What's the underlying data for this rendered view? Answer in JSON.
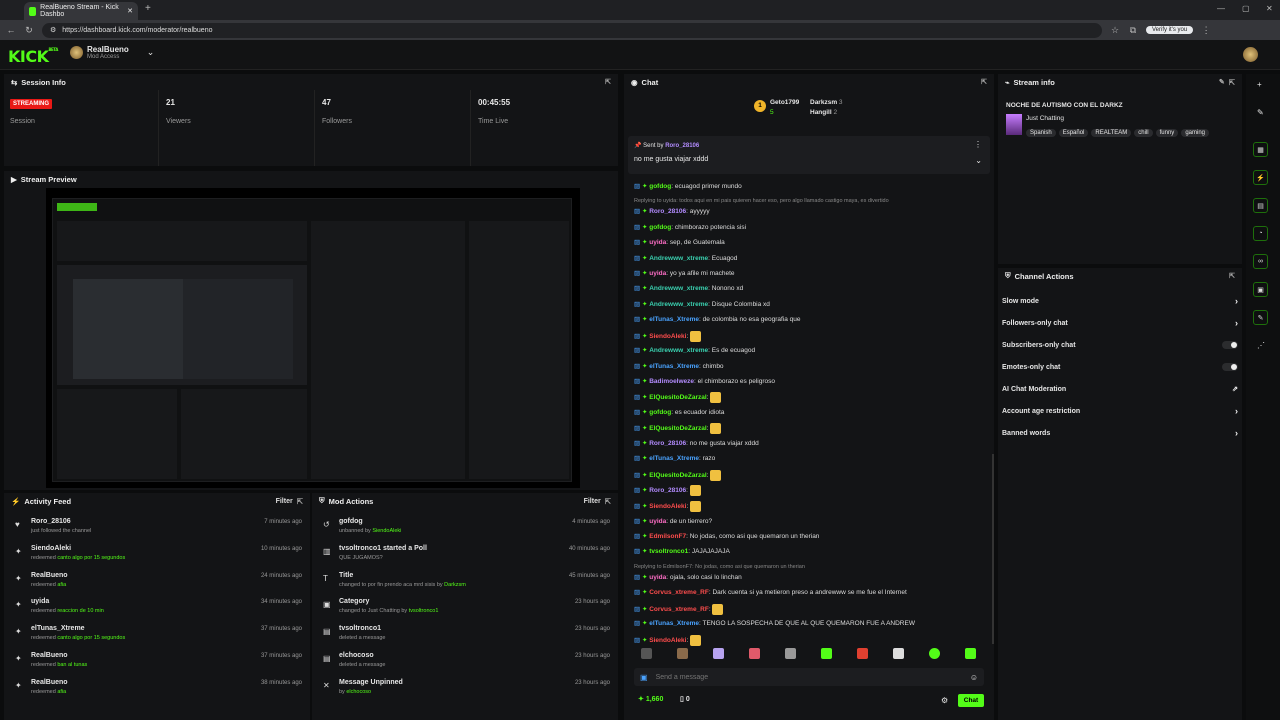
{
  "browser": {
    "tab_title": "RealBueno Stream - Kick Dashbo",
    "url": "https://dashboard.kick.com/moderator/realbueno",
    "verify_label": "Verify it's you"
  },
  "header": {
    "logo": "KICK",
    "logo_sup": "BETA",
    "channel_name": "RealBueno",
    "channel_role": "Mod Access"
  },
  "session": {
    "title": "Session Info",
    "status_badge": "STREAMING",
    "status_label": "Session",
    "viewers": "21",
    "viewers_label": "Viewers",
    "followers": "47",
    "followers_label": "Followers",
    "time_live": "00:45:55",
    "time_live_label": "Time Live"
  },
  "preview": {
    "title": "Stream Preview"
  },
  "activity": {
    "title": "Activity Feed",
    "filter": "Filter",
    "items": [
      {
        "icon": "heart-icon",
        "glyph": "♥",
        "user": "Roro_28106",
        "desc": "just followed the channel",
        "hl": "",
        "time": "7 minutes ago"
      },
      {
        "icon": "redeem-icon",
        "glyph": "✦",
        "user": "SiendoAleki",
        "desc": "redeemed",
        "hl": "canto algo por 15 segundos",
        "time": "10 minutes ago"
      },
      {
        "icon": "redeem-icon",
        "glyph": "✦",
        "user": "RealBueno",
        "desc": "redeemed",
        "hl": "afia",
        "time": "24 minutes ago"
      },
      {
        "icon": "redeem-icon",
        "glyph": "✦",
        "user": "uyida",
        "desc": "redeemed",
        "hl": "reaccion de 10 min",
        "time": "34 minutes ago"
      },
      {
        "icon": "redeem-icon",
        "glyph": "✦",
        "user": "elTunas_Xtreme",
        "desc": "redeemed",
        "hl": "canto algo por 15 segundos",
        "time": "37 minutes ago"
      },
      {
        "icon": "redeem-icon",
        "glyph": "✦",
        "user": "RealBueno",
        "desc": "redeemed",
        "hl": "ban al tunas",
        "time": "37 minutes ago"
      },
      {
        "icon": "redeem-icon",
        "glyph": "✦",
        "user": "RealBueno",
        "desc": "redeemed",
        "hl": "afia",
        "time": "38 minutes ago"
      }
    ]
  },
  "modactions": {
    "title": "Mod Actions",
    "filter": "Filter",
    "items": [
      {
        "icon": "unban-icon",
        "glyph": "↺",
        "title": "gofdog",
        "desc": "unbanned by",
        "hl": "SiendoAleki",
        "time": "4 minutes ago"
      },
      {
        "icon": "poll-icon",
        "glyph": "▥",
        "title": "tvsoltronco1 started a Poll",
        "desc": "QUE JUGAMOS?",
        "hl": "",
        "time": "40 minutes ago"
      },
      {
        "icon": "title-icon",
        "glyph": "T",
        "title": "Title",
        "desc": "changed to por fin prendo aca mrd sisis by",
        "hl": "Darkzsm",
        "time": "45 minutes ago"
      },
      {
        "icon": "category-icon",
        "glyph": "▣",
        "title": "Category",
        "desc": "changed to Just Chatting by",
        "hl": "tvsoltronco1",
        "time": "23 hours ago"
      },
      {
        "icon": "delete-icon",
        "glyph": "▤",
        "title": "tvsoltronco1",
        "desc": "deleted a message",
        "hl": "",
        "time": "23 hours ago"
      },
      {
        "icon": "delete-icon",
        "glyph": "▤",
        "title": "elchocoso",
        "desc": "deleted a message",
        "hl": "",
        "time": "23 hours ago"
      },
      {
        "icon": "unpin-icon",
        "glyph": "✕",
        "title": "Message Unpinned",
        "desc": "by",
        "hl": "elchocoso",
        "time": "23 hours ago"
      }
    ]
  },
  "chat": {
    "title": "Chat",
    "leaders": [
      {
        "name": "Geto1799",
        "count": "5"
      },
      {
        "name": "Darkzsm",
        "count": "3"
      },
      {
        "name": "Hangill",
        "count": "2"
      }
    ],
    "pinned": {
      "label": "Sent by",
      "user": "Roro_28106",
      "text": "no me gusta viajar xddd"
    },
    "messages": [
      {
        "user": "gofdog",
        "color": "#53fc18",
        "text": "ecuagod primer mundo",
        "reply": ""
      },
      {
        "user": "Roro_28106",
        "color": "#b38cff",
        "text": "ayyyyy",
        "reply": "Replying to uyida: todos aqui en mi pais quieren hacer eso, pero algo llamado castigo maya, es divertido"
      },
      {
        "user": "gofdog",
        "color": "#53fc18",
        "text": "chimborazo potencia sisi",
        "reply": ""
      },
      {
        "user": "uyida",
        "color": "#ff6ec7",
        "text": "sep, de Guatemala",
        "reply": ""
      },
      {
        "user": "Andrewww_xtreme",
        "color": "#3ad1b0",
        "text": "Ecuagod",
        "reply": ""
      },
      {
        "user": "uyida",
        "color": "#ff6ec7",
        "text": "yo ya afile mi machete",
        "reply": ""
      },
      {
        "user": "Andrewww_xtreme",
        "color": "#3ad1b0",
        "text": "Nonono xd",
        "reply": ""
      },
      {
        "user": "Andrewww_xtreme",
        "color": "#3ad1b0",
        "text": "Disque Colombia xd",
        "reply": ""
      },
      {
        "user": "elTunas_Xtreme",
        "color": "#4aa3ff",
        "text": "de colombia no esa geografia que",
        "reply": ""
      },
      {
        "user": "SiendoAleki",
        "color": "#ff4d4d",
        "text": "",
        "reply": ""
      },
      {
        "user": "Andrewww_xtreme",
        "color": "#3ad1b0",
        "text": "Es de ecuagod",
        "reply": ""
      },
      {
        "user": "elTunas_Xtreme",
        "color": "#4aa3ff",
        "text": "chimbo",
        "reply": ""
      },
      {
        "user": "Badimoelweze",
        "color": "#b38cff",
        "text": "el chimborazo es peligroso",
        "reply": ""
      },
      {
        "user": "ElQuesitoDeZarzal",
        "color": "#53fc18",
        "text": "",
        "reply": ""
      },
      {
        "user": "gofdog",
        "color": "#53fc18",
        "text": "es ecuador idiota",
        "reply": ""
      },
      {
        "user": "ElQuesitoDeZarzal",
        "color": "#53fc18",
        "text": "",
        "reply": ""
      },
      {
        "user": "Roro_28106",
        "color": "#b38cff",
        "text": "no me gusta viajar xddd",
        "reply": ""
      },
      {
        "user": "elTunas_Xtreme",
        "color": "#4aa3ff",
        "text": "razo",
        "reply": ""
      },
      {
        "user": "ElQuesitoDeZarzal",
        "color": "#53fc18",
        "text": "",
        "reply": ""
      },
      {
        "user": "Roro_28106",
        "color": "#b38cff",
        "text": "",
        "reply": ""
      },
      {
        "user": "SiendoAleki",
        "color": "#ff4d4d",
        "text": "",
        "reply": ""
      },
      {
        "user": "uyida",
        "color": "#ff6ec7",
        "text": "de un tierrero?",
        "reply": ""
      },
      {
        "user": "EdmilsonF7",
        "color": "#ff4d4d",
        "text": "No jodas, como asi que quemaron un therian",
        "reply": ""
      },
      {
        "user": "tvsoltronco1",
        "color": "#53fc18",
        "text": "JAJAJAJAJA",
        "reply": ""
      },
      {
        "user": "uyida",
        "color": "#ff6ec7",
        "text": "ojala, solo casi lo linchan",
        "reply": "Replying to EdmilsonF7: No jodas, como asi que quemaron un therian"
      },
      {
        "user": "Corvus_xtreme_RF",
        "color": "#ff4d4d",
        "text": "Dark cuenta si ya metieron preso a andrewww se me fue el Internet",
        "reply": ""
      },
      {
        "user": "Corvus_xtreme_RF",
        "color": "#ff4d4d",
        "text": "",
        "reply": ""
      },
      {
        "user": "elTunas_Xtreme",
        "color": "#4aa3ff",
        "text": "TENGO LA SOSPECHA DE QUE AL QUE QUEMARON FUE A ANDREW",
        "reply": ""
      },
      {
        "user": "SiendoAleki",
        "color": "#ff4d4d",
        "text": "",
        "reply": ""
      }
    ],
    "input_placeholder": "Send a message",
    "points": "1,660",
    "count": "0",
    "send": "Chat"
  },
  "streaminfo": {
    "title": "Stream info",
    "stream_title": "NOCHE DE AUTISMO CON EL DARKZ",
    "category": "Just Chatting",
    "tags": [
      "Spanish",
      "Español",
      "REALTEAM",
      "chill",
      "funny",
      "gaming"
    ]
  },
  "channelactions": {
    "title": "Channel Actions",
    "items": [
      {
        "label": "Slow mode",
        "control": "chevron"
      },
      {
        "label": "Followers-only chat",
        "control": "chevron"
      },
      {
        "label": "Subscribers-only chat",
        "control": "toggle"
      },
      {
        "label": "Emotes-only chat",
        "control": "toggle"
      },
      {
        "label": "AI Chat Moderation",
        "control": "external"
      },
      {
        "label": "Account age restriction",
        "control": "chevron"
      },
      {
        "label": "Banned words",
        "control": "chevron"
      }
    ]
  },
  "colors": {
    "accent": "#53fc18",
    "live": "#e91916",
    "bg": "#0b0c0d",
    "panel": "#131416"
  }
}
